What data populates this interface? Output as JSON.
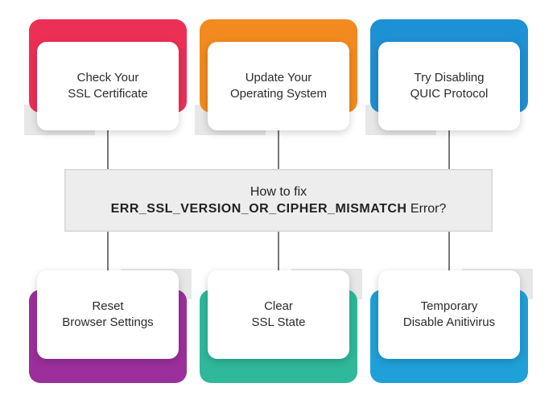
{
  "center": {
    "line1": "How to fix",
    "boldPart": "ERR_SSL_VERSION_OR_CIPHER_MISMATCH",
    "suffix": " Error?"
  },
  "cards": {
    "top": [
      {
        "line1": "Check Your",
        "line2": "SSL Certificate",
        "color": "#ec2f55"
      },
      {
        "line1": "Update Your",
        "line2": "Operating System",
        "color": "#f28a1f"
      },
      {
        "line1": "Try Disabling",
        "line2": "QUIC Protocol",
        "color": "#1e90d4"
      }
    ],
    "bottom": [
      {
        "line1": "Reset",
        "line2": "Browser Settings",
        "color": "#9b2f9b"
      },
      {
        "line1": "Clear",
        "line2": "SSL State",
        "color": "#2fb89a"
      },
      {
        "line1": "Temporary",
        "line2": "Disable Anitivirus",
        "color": "#1fa0d8"
      }
    ]
  }
}
